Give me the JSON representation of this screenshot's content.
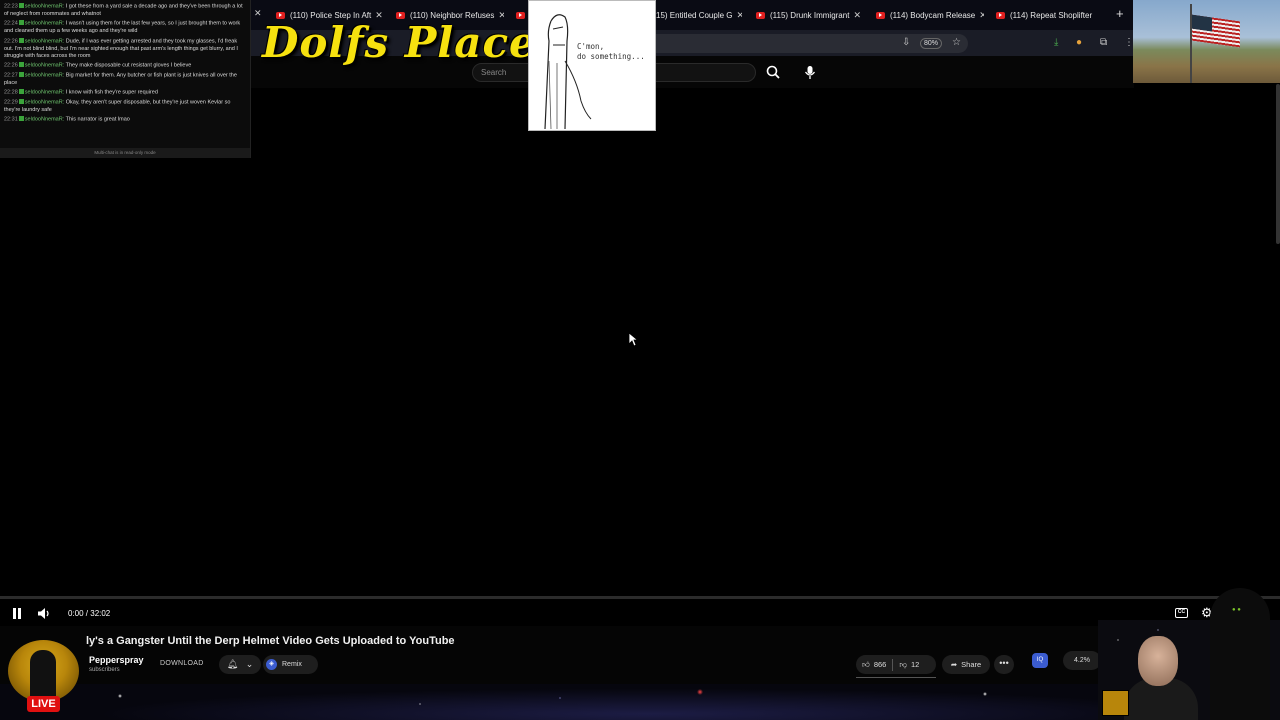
{
  "browser": {
    "tabs": [
      {
        "label": "(110) Police Step In Aft"
      },
      {
        "label": "(110) Neighbor Refuses"
      },
      {
        "label": "15) Entitled Couple G"
      },
      {
        "label": "(115) Drunk Immigrant"
      },
      {
        "label": "(114) Bodycam Release"
      },
      {
        "label": "(114) Repeat Shoplifter"
      }
    ],
    "zoom": "80%"
  },
  "overlay": {
    "logo_text": "Dolfs Place",
    "comic_text_line1": "C'mon,",
    "comic_text_line2": "do something..."
  },
  "youtube": {
    "search_placeholder": "Search"
  },
  "chat": {
    "messages": [
      {
        "time": "22:23",
        "user": "seldooNnemaR:",
        "text": "I got these from a yard sale a decade ago and they've been through a lot of neglect from roommates and whatnot"
      },
      {
        "time": "22:24",
        "user": "seldooNnemaR:",
        "text": "I wasn't using them for the last few years, so I just brought them to work and cleaned them up a few weeks ago and they're wild"
      },
      {
        "time": "22:26",
        "user": "seldooNnemaR:",
        "text": "Dude, if I was ever getting arrested and they took my glasses, I'd freak out. I'm not blind blind, but I'm near sighted enough that past arm's length things get blurry, and I struggle with faces across the room"
      },
      {
        "time": "22:26",
        "user": "seldooNnemaR:",
        "text": "They make disposable cut resistant gloves I believe"
      },
      {
        "time": "22:27",
        "user": "seldooNnemaR:",
        "text": "Big market for them. Any butcher or fish plant is just knives all over the place"
      },
      {
        "time": "22:28",
        "user": "seldooNnemaR:",
        "text": "I know with fish they're super required"
      },
      {
        "time": "22:29",
        "user": "seldooNnemaR:",
        "text": "Okay, they aren't super disposable, but they're just woven Kevlar so they're laundry safe"
      },
      {
        "time": "22:31",
        "user": "seldooNnemaR:",
        "text": "This narrator is great lmao"
      }
    ],
    "footer": "Multi-chat is in read-only mode"
  },
  "player": {
    "time": "0:00 / 32:02",
    "progress": 0,
    "cc_label": "CC"
  },
  "video": {
    "title": "ly's a Gangster Until the Derp Helmet Video Gets Uploaded to YouTube",
    "channel": "Pepperspray",
    "subscribers": "subscribers",
    "download_label": "DOWNLOAD",
    "remix_label": "Remix",
    "likes": "866",
    "dislikes": "12",
    "share_label": "Share",
    "percent": "4.2%",
    "live_label": "LIVE"
  },
  "colors": {
    "logo_yellow": "#f6e10f",
    "live_red": "#e01010",
    "chat_user_green": "#6ec46e",
    "remix_blue": "#3b5cd0"
  }
}
